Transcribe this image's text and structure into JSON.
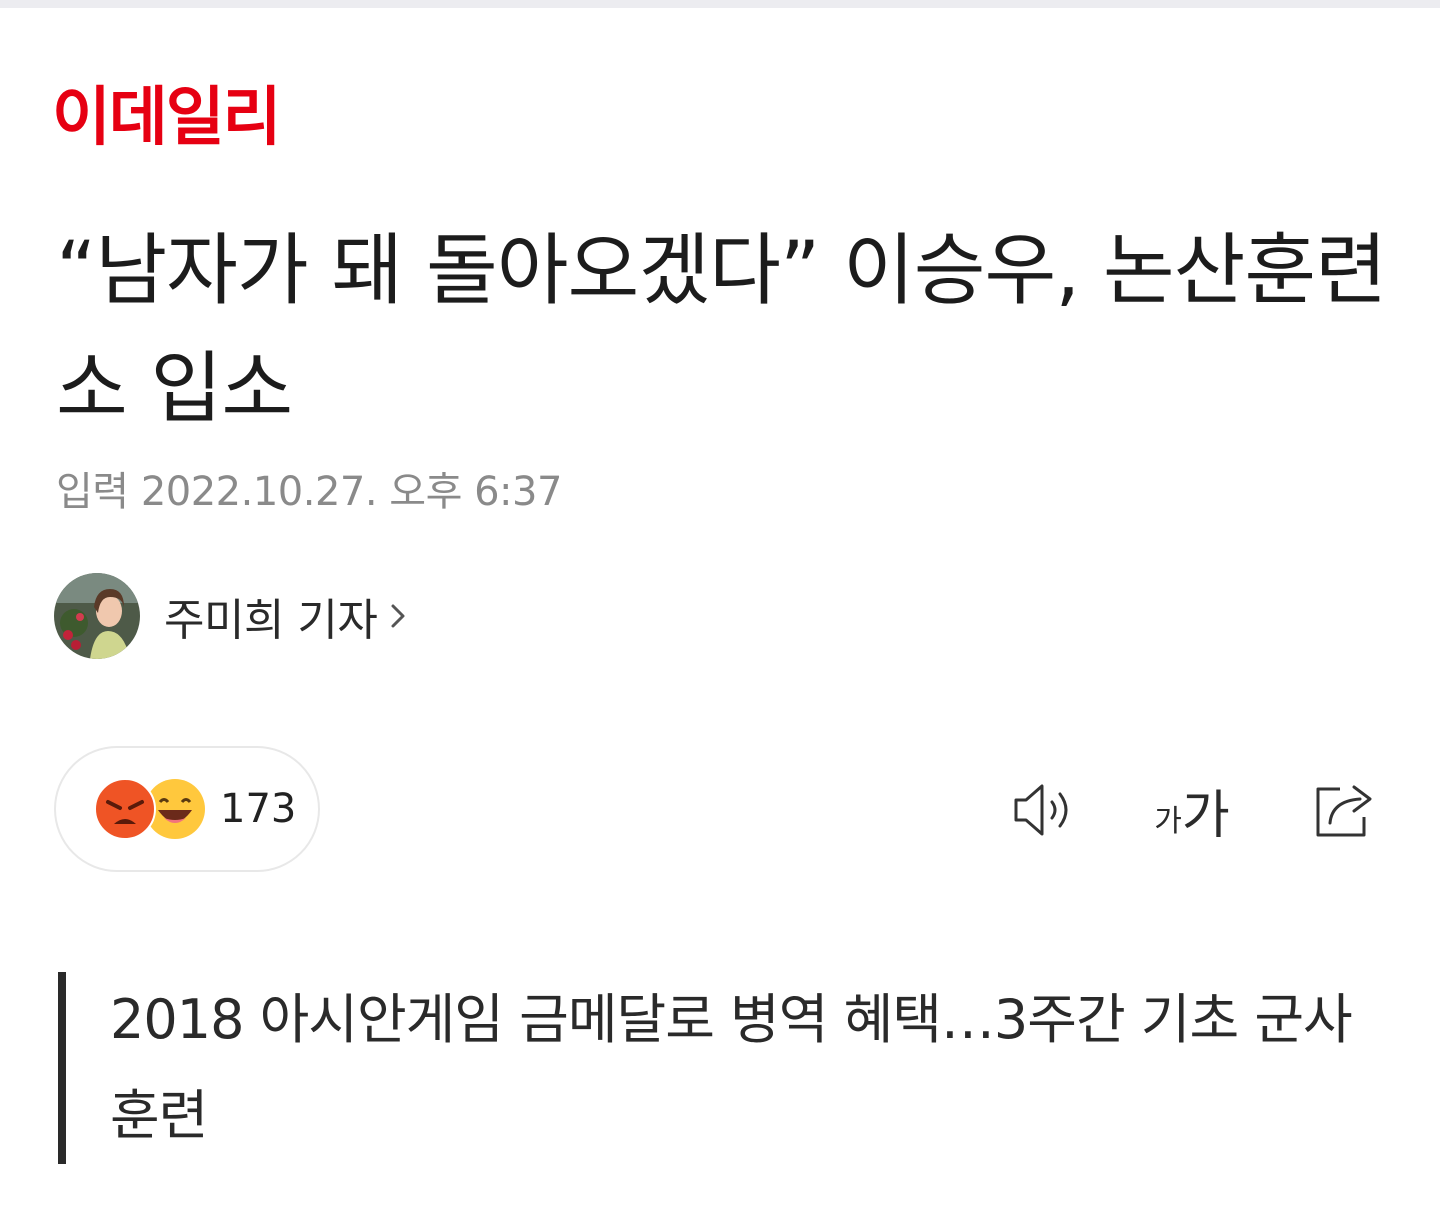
{
  "publisher": {
    "logo_text": "이데일리",
    "brand_color": "#e60012"
  },
  "article": {
    "headline": "“남자가 돼 돌아오겠다” 이승우, 논산훈련소 입소",
    "published": "입력 2022.10.27. 오후 6:37",
    "author": "주미희 기자",
    "summary": "2018 아시안게임 금메달로 병역 혜택…3주간 기초 군사훈련"
  },
  "reactions": {
    "count": "173",
    "emojis": [
      "angry-face-icon",
      "laughing-face-icon"
    ]
  },
  "toolbar": {
    "font_size_small": "가",
    "font_size_large": "가",
    "icons": [
      "speaker-icon",
      "font-size-icon",
      "share-icon"
    ]
  }
}
